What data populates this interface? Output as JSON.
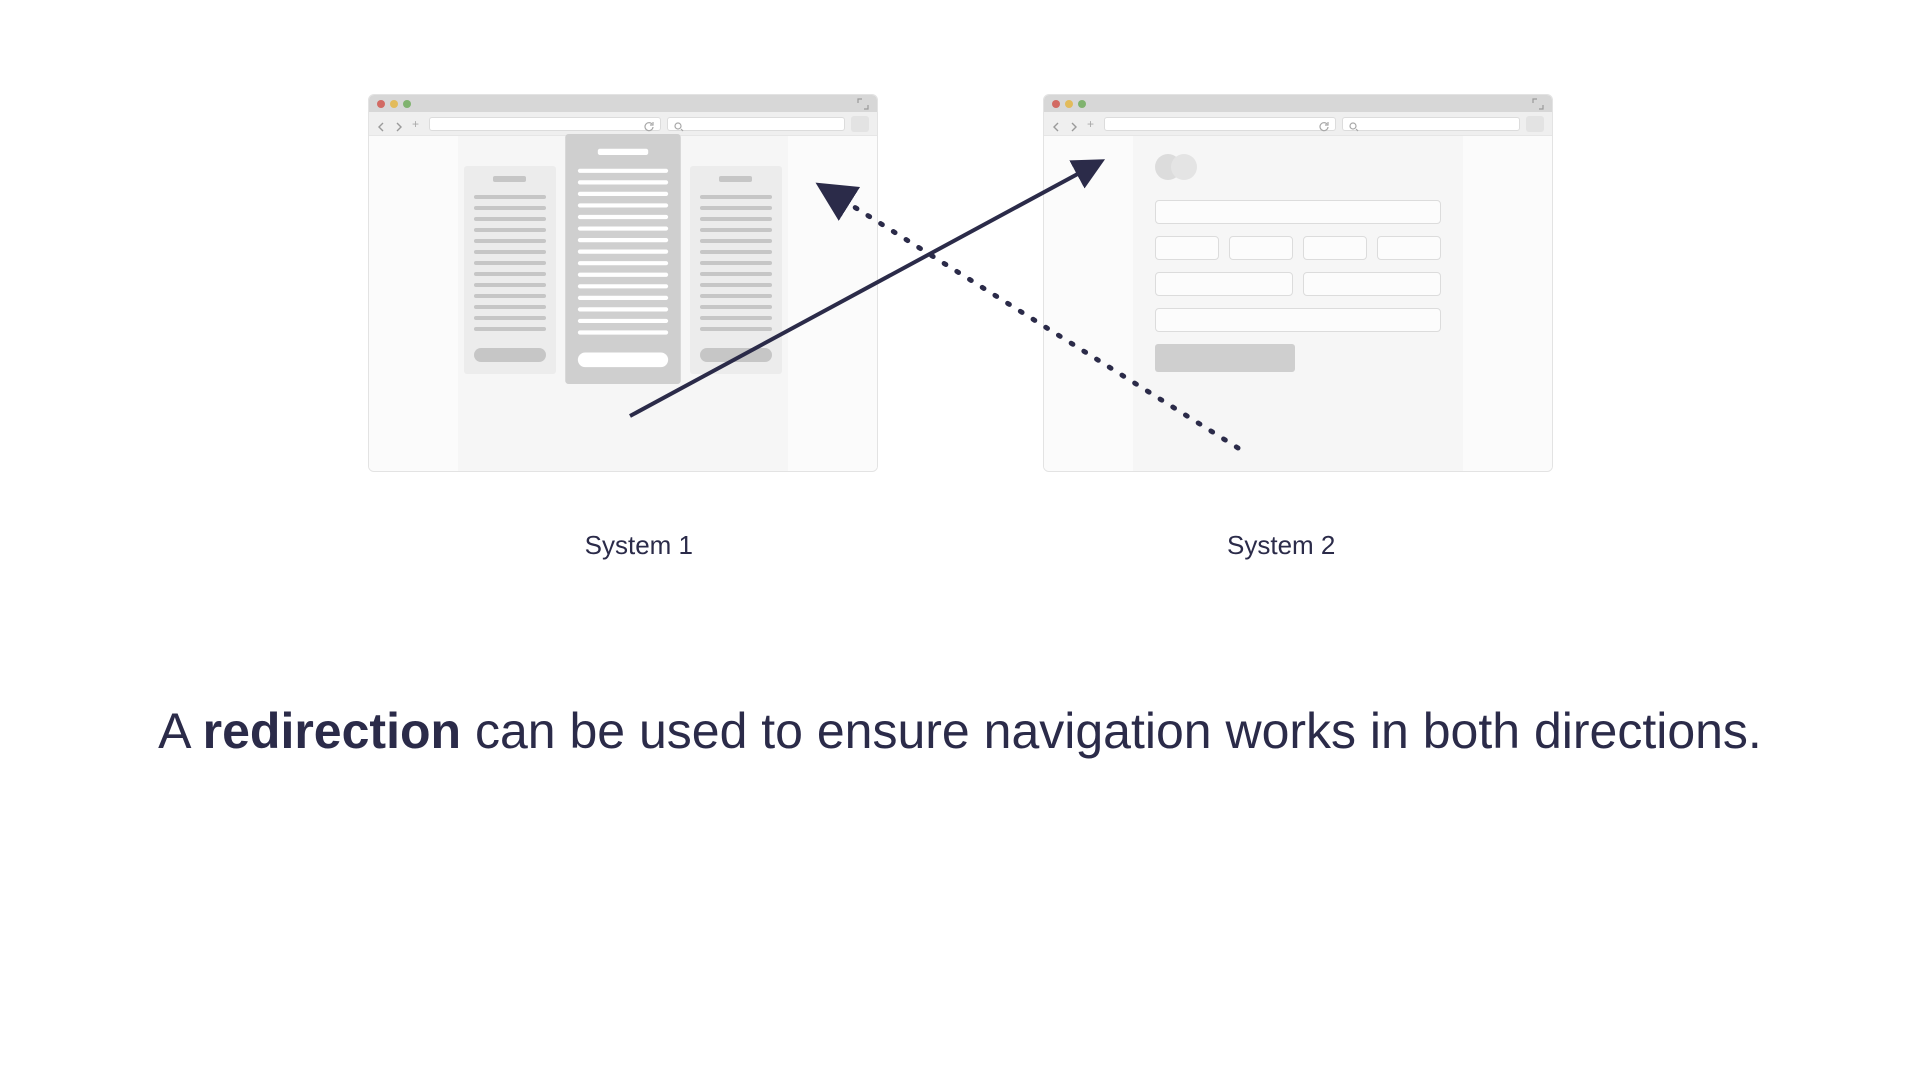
{
  "labels": {
    "system1": "System 1",
    "system2": "System 2"
  },
  "caption": {
    "prefix": "A ",
    "bold": "redirection",
    "suffix": " can be used to ensure navigation works in both directions."
  },
  "icons": {
    "close": "close-icon",
    "minimize": "minimize-icon",
    "maximize": "maximize-icon",
    "back": "back-arrow-icon",
    "forward": "forward-arrow-icon",
    "add_tab": "plus-icon",
    "refresh": "refresh-icon",
    "search": "search-icon",
    "expand": "expand-icon"
  },
  "colors": {
    "ink": "#2b2b49",
    "browser_chrome": "#d7d7d7",
    "browser_toolbar": "#efefef",
    "panel": "#f6f6f6",
    "placeholder": "#c6c6c6"
  },
  "arrows": {
    "solid_from": "system1.card.button",
    "solid_to": "system2.browser",
    "dotted_from": "system2.submit",
    "dotted_to": "system1.browser"
  }
}
